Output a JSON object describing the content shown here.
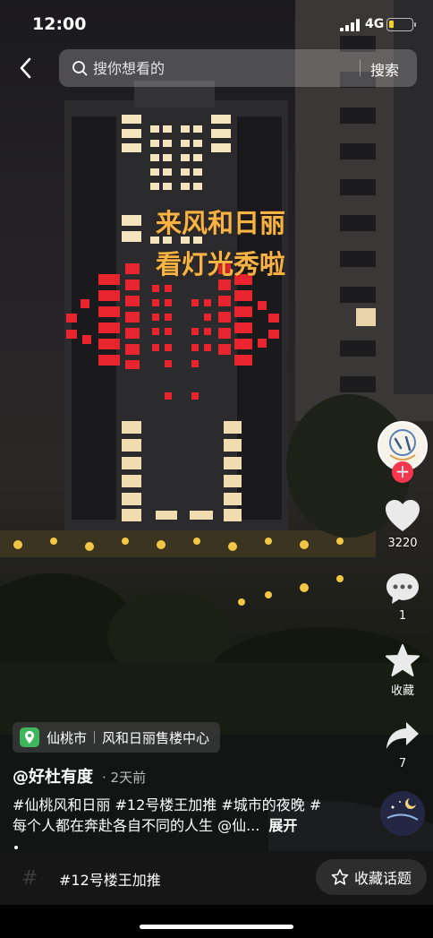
{
  "status_bar": {
    "time": "12:00",
    "network": "4G"
  },
  "search": {
    "placeholder": "搜你想看的",
    "button_label": "搜索"
  },
  "overlay": {
    "line1": "来风和日丽",
    "line2": "看灯光秀啦"
  },
  "actions": {
    "likes": "3220",
    "comments": "1",
    "favorite_label": "收藏",
    "shares": "7"
  },
  "location": {
    "city": "仙桃市",
    "place": "风和日丽售楼中心"
  },
  "author": {
    "handle": "@好杜有度",
    "time": "· 2天前"
  },
  "description": {
    "line1": "#仙桃风和日丽 #12号楼王加推 #城市的夜晚 #",
    "line2": "每个人都在奔赴各自不同的人生 @仙...",
    "expand": "展开"
  },
  "topic_bar": {
    "topic": "#12号楼王加推",
    "collect_label": "收藏话题"
  },
  "colors": {
    "caption": "#f7b344",
    "follow_badge": "#f5364f",
    "location_pin": "#3fb65c"
  }
}
